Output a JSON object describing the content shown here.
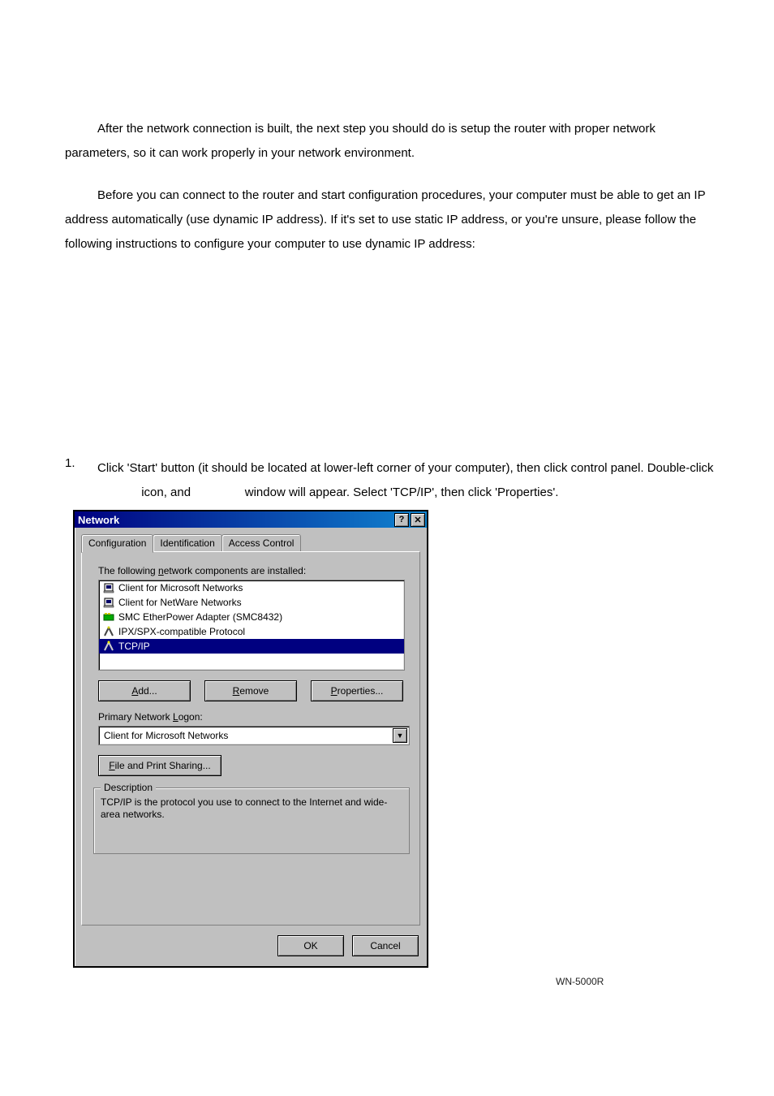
{
  "paragraphs": {
    "p1": "After the network connection is built, the next step you should do is setup the router with proper network parameters, so it can work properly in your network environment.",
    "p2": "Before you can connect to the router and start configuration procedures, your computer must be able to get an IP address automatically (use dynamic IP address). If it's set to use static IP address, or you're unsure, please follow the following instructions to configure your computer to use dynamic IP address:"
  },
  "step": {
    "num": "1.",
    "text_a": "Click 'Start' button (it should be located at lower-left corner of your computer), then click control panel. Double-click ",
    "text_b": " icon, and ",
    "text_c": " window will appear. Select 'TCP/IP', then click 'Properties'."
  },
  "footer_model": "WN-5000R",
  "dialog": {
    "title": "Network",
    "tabs": {
      "configuration": "Configuration",
      "identification": "Identification",
      "access": "Access Control"
    },
    "components_label": "The following network components are installed:",
    "list": {
      "0": "Client for Microsoft Networks",
      "1": "Client for NetWare Networks",
      "2": "SMC EtherPower Adapter (SMC8432)",
      "3": "IPX/SPX-compatible Protocol",
      "4": "TCP/IP"
    },
    "buttons": {
      "add": "Add...",
      "remove": "Remove",
      "properties": "Properties..."
    },
    "primary_logon_label": "Primary Network Logon:",
    "primary_logon_value": "Client for Microsoft Networks",
    "fps": "File and Print Sharing...",
    "group_title": "Description",
    "description": "TCP/IP is the protocol you use to connect to the Internet and wide-area networks.",
    "ok": "OK",
    "cancel": "Cancel"
  }
}
